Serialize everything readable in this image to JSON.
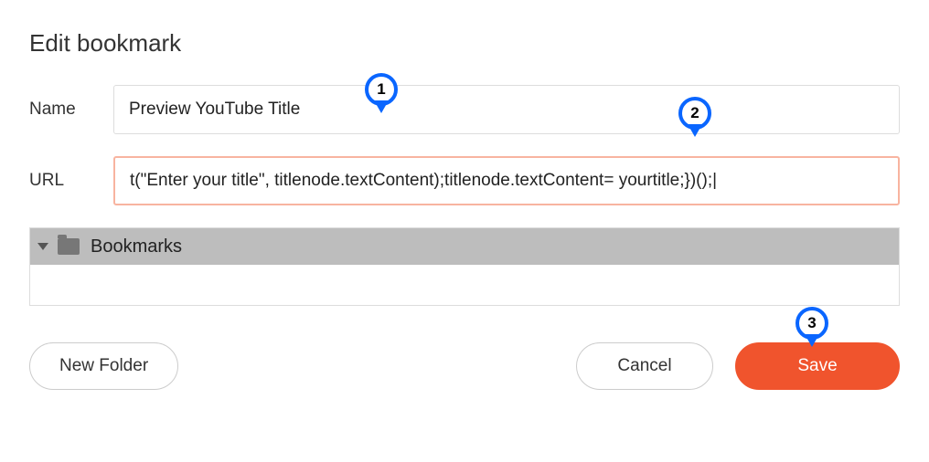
{
  "dialog": {
    "title": "Edit bookmark",
    "name_label": "Name",
    "name_value": "Preview YouTube Title",
    "url_label": "URL",
    "url_value": "t(\"Enter your title\", titlenode.textContent);titlenode.textContent= yourtitle;})();|"
  },
  "tree": {
    "root_label": "Bookmarks"
  },
  "buttons": {
    "new_folder": "New Folder",
    "cancel": "Cancel",
    "save": "Save"
  },
  "annotations": {
    "m1": "1",
    "m2": "2",
    "m3": "3"
  }
}
